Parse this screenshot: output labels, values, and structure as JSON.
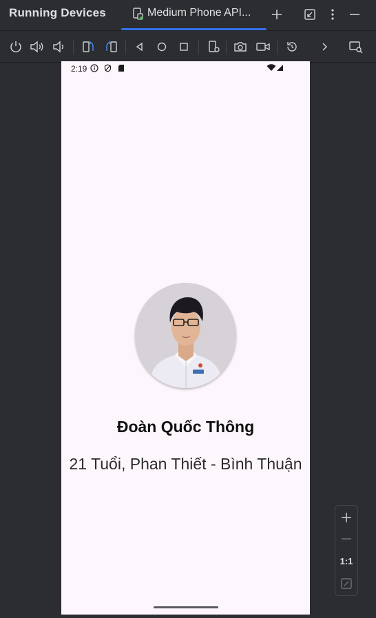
{
  "panel": {
    "title": "Running Devices",
    "tab_label": "Medium Phone API..."
  },
  "toolbar": {
    "icons": [
      "power-icon",
      "volume-up-icon",
      "volume-down-icon",
      "rotate-left-icon",
      "rotate-right-icon",
      "back-icon",
      "home-icon",
      "overview-icon",
      "device-settings-icon",
      "screenshot-icon",
      "screen-record-icon",
      "snapshot-restore-icon",
      "more-chevron-icon",
      "mirror-device-icon"
    ]
  },
  "device": {
    "status_time": "2:19",
    "profile_name": "Đoàn Quốc Thông",
    "profile_info": "21 Tuổi, Phan Thiết - Bình Thuận"
  },
  "zoom": {
    "ratio_label": "1:1"
  },
  "colors": {
    "accent": "#3574f0",
    "ide_background": "#2b2d30",
    "phone_background": "#fdf7fd"
  }
}
